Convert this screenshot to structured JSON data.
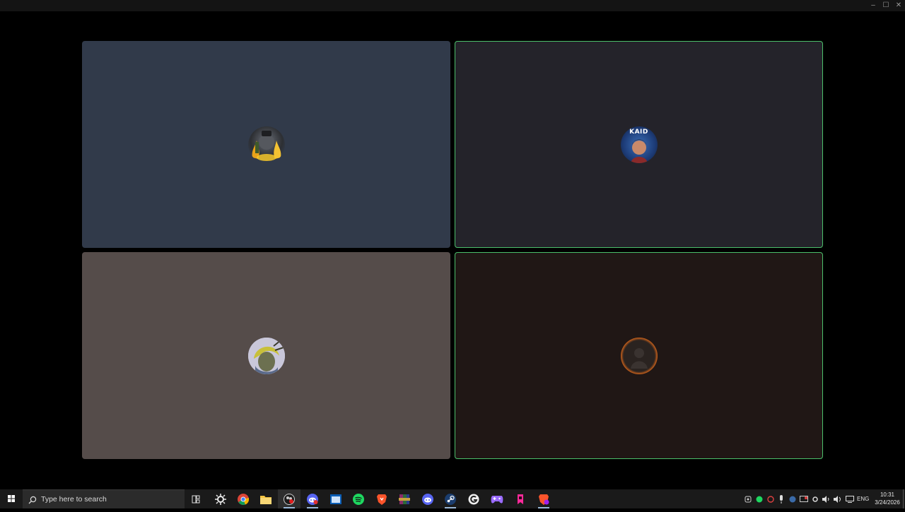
{
  "window": {
    "controls": [
      {
        "name": "minimize-button",
        "glyph": "–"
      },
      {
        "name": "maximize-button",
        "glyph": "☐"
      },
      {
        "name": "close-button",
        "glyph": "✕"
      }
    ]
  },
  "call": {
    "tiles": [
      {
        "name": "participant-tile-1",
        "bg": "#313a4a",
        "speaking": false,
        "avatar": "flaming-character-avatar"
      },
      {
        "name": "participant-tile-2",
        "bg": "#24232a",
        "speaking": true,
        "avatar": "kaid-avatar",
        "avatar_text": "KAID"
      },
      {
        "name": "participant-tile-3",
        "bg": "#554c4a",
        "speaking": false,
        "avatar": "yellow-hair-character-avatar"
      },
      {
        "name": "participant-tile-4",
        "bg": "#201715",
        "speaking": true,
        "avatar": "fire-ring-avatar"
      }
    ],
    "speaking_color": "#4bbf6a"
  },
  "taskbar": {
    "search_placeholder": "Type here to search",
    "apps": [
      "task-view-icon",
      "steelseries-icon",
      "chrome-icon",
      "file-explorer-icon",
      "obs-icon",
      "discord-ptb-icon",
      "window-app-icon",
      "spotify-icon",
      "brave-icon",
      "winrar-icon",
      "discord-icon",
      "steam-icon",
      "gaming-app-icon",
      "gamepad-icon",
      "pink-app-icon",
      "brave-beta-icon"
    ],
    "tray": {
      "language": "ENG",
      "time": "10:31",
      "date": "3/24/2026"
    }
  }
}
